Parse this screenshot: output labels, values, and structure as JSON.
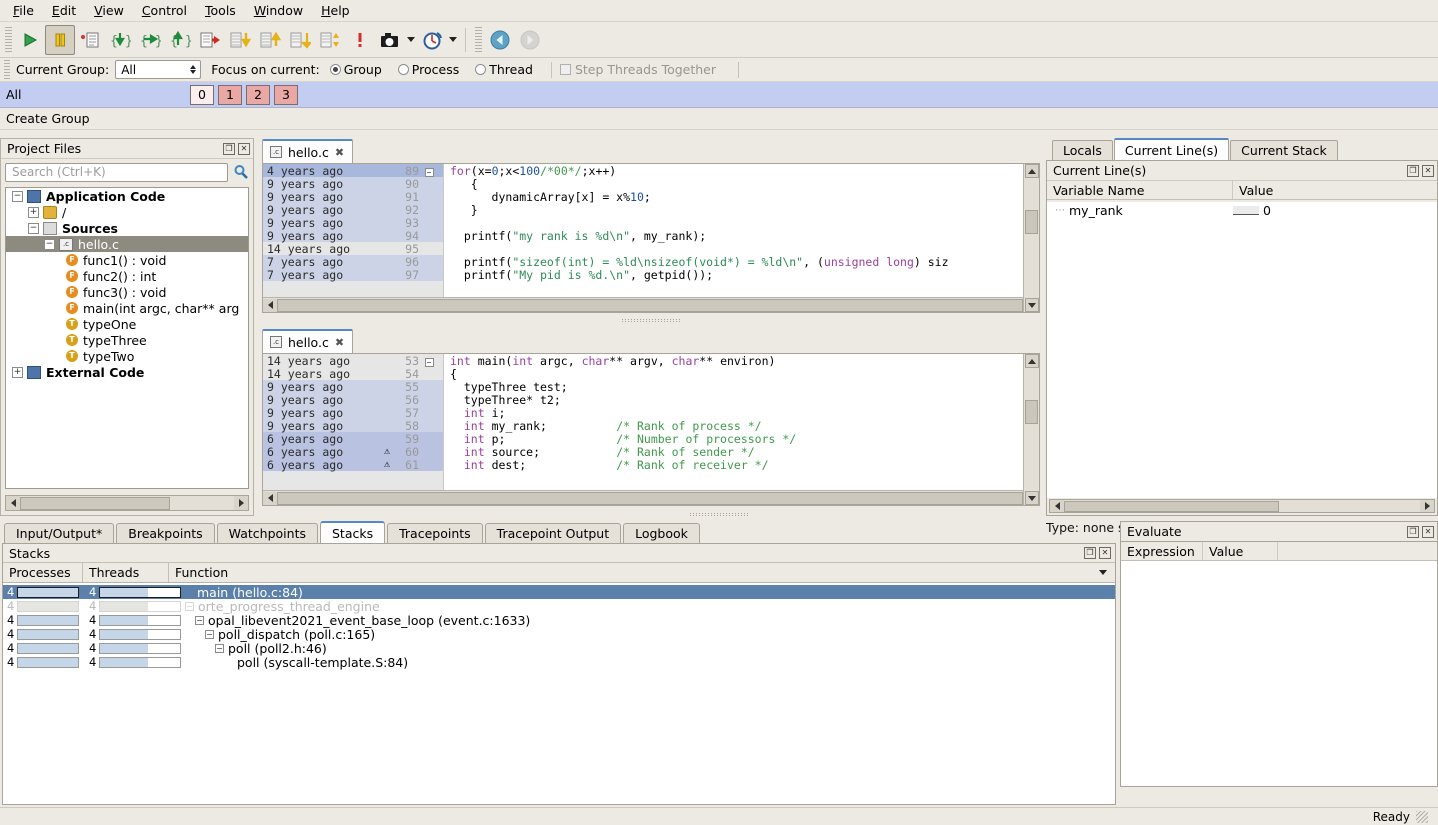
{
  "menu": {
    "items": [
      {
        "label": "File",
        "mnemonic": "F"
      },
      {
        "label": "Edit",
        "mnemonic": "E"
      },
      {
        "label": "View",
        "mnemonic": "V"
      },
      {
        "label": "Control",
        "mnemonic": "C"
      },
      {
        "label": "Tools",
        "mnemonic": "T"
      },
      {
        "label": "Window",
        "mnemonic": "W"
      },
      {
        "label": "Help",
        "mnemonic": "H"
      }
    ]
  },
  "toolbar": {
    "buttons": [
      {
        "name": "run-button",
        "icon": "play-icon",
        "state": "enabled"
      },
      {
        "name": "pause-button",
        "icon": "pause-icon",
        "state": "pressed"
      },
      {
        "name": "step-instruction-button",
        "icon": "step-instruction-icon",
        "state": "enabled"
      },
      {
        "name": "step-into-button",
        "icon": "step-into-icon",
        "state": "enabled"
      },
      {
        "name": "step-over-button",
        "icon": "step-over-icon",
        "state": "enabled"
      },
      {
        "name": "step-out-button",
        "icon": "step-out-icon",
        "state": "enabled"
      },
      {
        "name": "run-to-line-button",
        "icon": "run-to-line-icon",
        "state": "enabled"
      },
      {
        "name": "next-button",
        "icon": "next-down-icon",
        "state": "enabled"
      },
      {
        "name": "previous-button",
        "icon": "previous-up-icon",
        "state": "enabled"
      },
      {
        "name": "go-button",
        "icon": "go-down-icon",
        "state": "enabled"
      },
      {
        "name": "next-instruction-button",
        "icon": "updown-icon",
        "state": "enabled"
      },
      {
        "name": "halt-button",
        "icon": "exclamation-icon",
        "state": "enabled"
      },
      {
        "name": "snapshot-button",
        "icon": "camera-icon",
        "state": "enabled"
      },
      {
        "name": "timer-button",
        "icon": "stopwatch-icon",
        "state": "enabled"
      },
      {
        "name": "back-button",
        "icon": "back-arrow-icon",
        "state": "enabled"
      },
      {
        "name": "forward-button",
        "icon": "forward-arrow-icon",
        "state": "disabled"
      }
    ]
  },
  "group_bar": {
    "current_group_label": "Current Group:",
    "current_group_value": "All",
    "focus_label": "Focus on current:",
    "focus_options": [
      {
        "label": "Group",
        "selected": true
      },
      {
        "label": "Process",
        "selected": false
      },
      {
        "label": "Thread",
        "selected": false
      }
    ],
    "step_threads_label": "Step Threads Together",
    "step_threads_checked": false,
    "step_threads_enabled": false
  },
  "process_bar": {
    "group_label": "All",
    "processes": [
      {
        "id": "0",
        "selected": true
      },
      {
        "id": "1",
        "selected": false
      },
      {
        "id": "2",
        "selected": false
      },
      {
        "id": "3",
        "selected": false
      }
    ],
    "create_group_label": "Create Group",
    "selected_color": "#fdeeee",
    "process_color": "#eaa8a5",
    "bar_color": "#c3cdf2"
  },
  "project_files": {
    "title": "Project Files",
    "search_placeholder": "Search (Ctrl+K)",
    "search_value": "",
    "tree": [
      {
        "label": "Application Code",
        "depth": 0,
        "icon": "book-icon",
        "expander": "-",
        "selected": false
      },
      {
        "label": "/",
        "depth": 1,
        "icon": "folder-icon",
        "expander": "+",
        "selected": false
      },
      {
        "label": "Sources",
        "depth": 1,
        "icon": "sources-icon",
        "expander": "-",
        "selected": false
      },
      {
        "label": "hello.c",
        "depth": 2,
        "icon": "c-file-icon",
        "expander": "-",
        "selected": true
      },
      {
        "label": "func1() : void",
        "depth": 3,
        "icon": "function-badge",
        "expander": "",
        "selected": false
      },
      {
        "label": "func2() : int",
        "depth": 3,
        "icon": "function-badge",
        "expander": "",
        "selected": false
      },
      {
        "label": "func3() : void",
        "depth": 3,
        "icon": "function-badge",
        "expander": "",
        "selected": false
      },
      {
        "label": "main(int argc, char** arg",
        "depth": 3,
        "icon": "function-badge",
        "expander": "",
        "selected": false
      },
      {
        "label": "typeOne",
        "depth": 3,
        "icon": "type-badge",
        "expander": "",
        "selected": false
      },
      {
        "label": "typeThree",
        "depth": 3,
        "icon": "type-badge",
        "expander": "",
        "selected": false
      },
      {
        "label": "typeTwo",
        "depth": 3,
        "icon": "type-badge",
        "expander": "",
        "selected": false
      },
      {
        "label": "External Code",
        "depth": 0,
        "icon": "book-icon",
        "expander": "+",
        "selected": false
      }
    ]
  },
  "editor_top": {
    "tab_label": "hello.c",
    "lines": [
      {
        "blame": "4 years ago",
        "num": "89",
        "fold": "-",
        "warn": "",
        "highlight": "strong",
        "code": "for(x=0;x<100/*00*/;x++)"
      },
      {
        "blame": "9 years ago",
        "num": "90",
        "fold": "",
        "warn": "",
        "highlight": "light",
        "code": "   {"
      },
      {
        "blame": "9 years ago",
        "num": "91",
        "fold": "",
        "warn": "",
        "highlight": "light",
        "code": "      dynamicArray[x] = x%10;"
      },
      {
        "blame": "9 years ago",
        "num": "92",
        "fold": "",
        "warn": "",
        "highlight": "light",
        "code": "   }"
      },
      {
        "blame": "9 years ago",
        "num": "93",
        "fold": "",
        "warn": "",
        "highlight": "light",
        "code": ""
      },
      {
        "blame": "9 years ago",
        "num": "94",
        "fold": "",
        "warn": "",
        "highlight": "light",
        "code": "  printf(\"my rank is %d\\n\", my_rank);"
      },
      {
        "blame": "14 years ago",
        "num": "95",
        "fold": "",
        "warn": "",
        "highlight": "none",
        "code": ""
      },
      {
        "blame": "7 years ago",
        "num": "96",
        "fold": "",
        "warn": "",
        "highlight": "light",
        "code": "  printf(\"sizeof(int) = %ld\\nsizeof(void*) = %ld\\n\", (unsigned long) siz"
      },
      {
        "blame": "7 years ago",
        "num": "97",
        "fold": "",
        "warn": "",
        "highlight": "light",
        "code": "  printf(\"My pid is %d.\\n\", getpid());"
      }
    ]
  },
  "editor_bottom": {
    "tab_label": "hello.c",
    "lines": [
      {
        "blame": "14 years ago",
        "num": "53",
        "fold": "-",
        "warn": "",
        "highlight": "none",
        "code": "int main(int argc, char** argv, char** environ)"
      },
      {
        "blame": "14 years ago",
        "num": "54",
        "fold": "",
        "warn": "",
        "highlight": "none",
        "code": "{"
      },
      {
        "blame": "9 years ago",
        "num": "55",
        "fold": "",
        "warn": "",
        "highlight": "light",
        "code": "  typeThree test;"
      },
      {
        "blame": "9 years ago",
        "num": "56",
        "fold": "",
        "warn": "",
        "highlight": "light",
        "code": "  typeThree* t2;"
      },
      {
        "blame": "9 years ago",
        "num": "57",
        "fold": "",
        "warn": "",
        "highlight": "light",
        "code": "  int i;"
      },
      {
        "blame": "9 years ago",
        "num": "58",
        "fold": "",
        "warn": "",
        "highlight": "light",
        "code": "  int my_rank;          /* Rank of process */"
      },
      {
        "blame": "6 years ago",
        "num": "59",
        "fold": "",
        "warn": "",
        "highlight": "strong",
        "code": "  int p;                /* Number of processors */"
      },
      {
        "blame": "6 years ago",
        "num": "60",
        "fold": "",
        "warn": "warning",
        "highlight": "strong",
        "code": "  int source;           /* Rank of sender */"
      },
      {
        "blame": "6 years ago",
        "num": "61",
        "fold": "",
        "warn": "warning",
        "highlight": "strong",
        "code": "  int dest;             /* Rank of receiver */"
      }
    ]
  },
  "right_panel": {
    "tabs": [
      {
        "label": "Locals",
        "active": false
      },
      {
        "label": "Current Line(s)",
        "active": true
      },
      {
        "label": "Current Stack",
        "active": false
      }
    ],
    "title": "Current Line(s)",
    "columns": [
      "Variable Name",
      "Value"
    ],
    "rows": [
      {
        "name": "my_rank",
        "value": "0"
      }
    ],
    "type_status": "Type: none selected"
  },
  "bottom_tabs": [
    {
      "label": "Input/Output*",
      "active": false
    },
    {
      "label": "Breakpoints",
      "active": false
    },
    {
      "label": "Watchpoints",
      "active": false
    },
    {
      "label": "Stacks",
      "active": true
    },
    {
      "label": "Tracepoints",
      "active": false
    },
    {
      "label": "Tracepoint Output",
      "active": false
    },
    {
      "label": "Logbook",
      "active": false
    }
  ],
  "stacks": {
    "title": "Stacks",
    "columns": [
      "Processes",
      "Threads",
      "Function"
    ],
    "rows": [
      {
        "processes": "4",
        "proc_pct": 100,
        "threads": "4",
        "thread_pct": 60,
        "function": "main (hello.c:84)",
        "indent": 0,
        "expander": "",
        "selected": true,
        "dim": false
      },
      {
        "processes": "4",
        "proc_pct": 100,
        "threads": "4",
        "thread_pct": 60,
        "function": "orte_progress_thread_engine",
        "indent": 0,
        "expander": "-",
        "selected": false,
        "dim": true
      },
      {
        "processes": "4",
        "proc_pct": 100,
        "threads": "4",
        "thread_pct": 60,
        "function": "opal_libevent2021_event_base_loop (event.c:1633)",
        "indent": 1,
        "expander": "-",
        "selected": false,
        "dim": false
      },
      {
        "processes": "4",
        "proc_pct": 100,
        "threads": "4",
        "thread_pct": 60,
        "function": "poll_dispatch (poll.c:165)",
        "indent": 2,
        "expander": "-",
        "selected": false,
        "dim": false
      },
      {
        "processes": "4",
        "proc_pct": 100,
        "threads": "4",
        "thread_pct": 60,
        "function": "poll (poll2.h:46)",
        "indent": 3,
        "expander": "-",
        "selected": false,
        "dim": false
      },
      {
        "processes": "4",
        "proc_pct": 100,
        "threads": "4",
        "thread_pct": 60,
        "function": "poll (syscall-template.S:84)",
        "indent": 4,
        "expander": "",
        "selected": false,
        "dim": false
      }
    ]
  },
  "evaluate": {
    "title": "Evaluate",
    "columns": [
      "Expression",
      "Value"
    ],
    "rows": []
  },
  "status_bar": {
    "message": "Ready"
  },
  "colors": {
    "accent": "#5588c4",
    "selection": "#5b81ab",
    "group_bar": "#c3cdf2",
    "process_box": "#eaa8a5",
    "tree_selection": "#8d8a80",
    "keyword": "#9b3fa0",
    "string": "#2e8b57",
    "comment": "#3f9a4c",
    "number": "#1b4fa8"
  }
}
